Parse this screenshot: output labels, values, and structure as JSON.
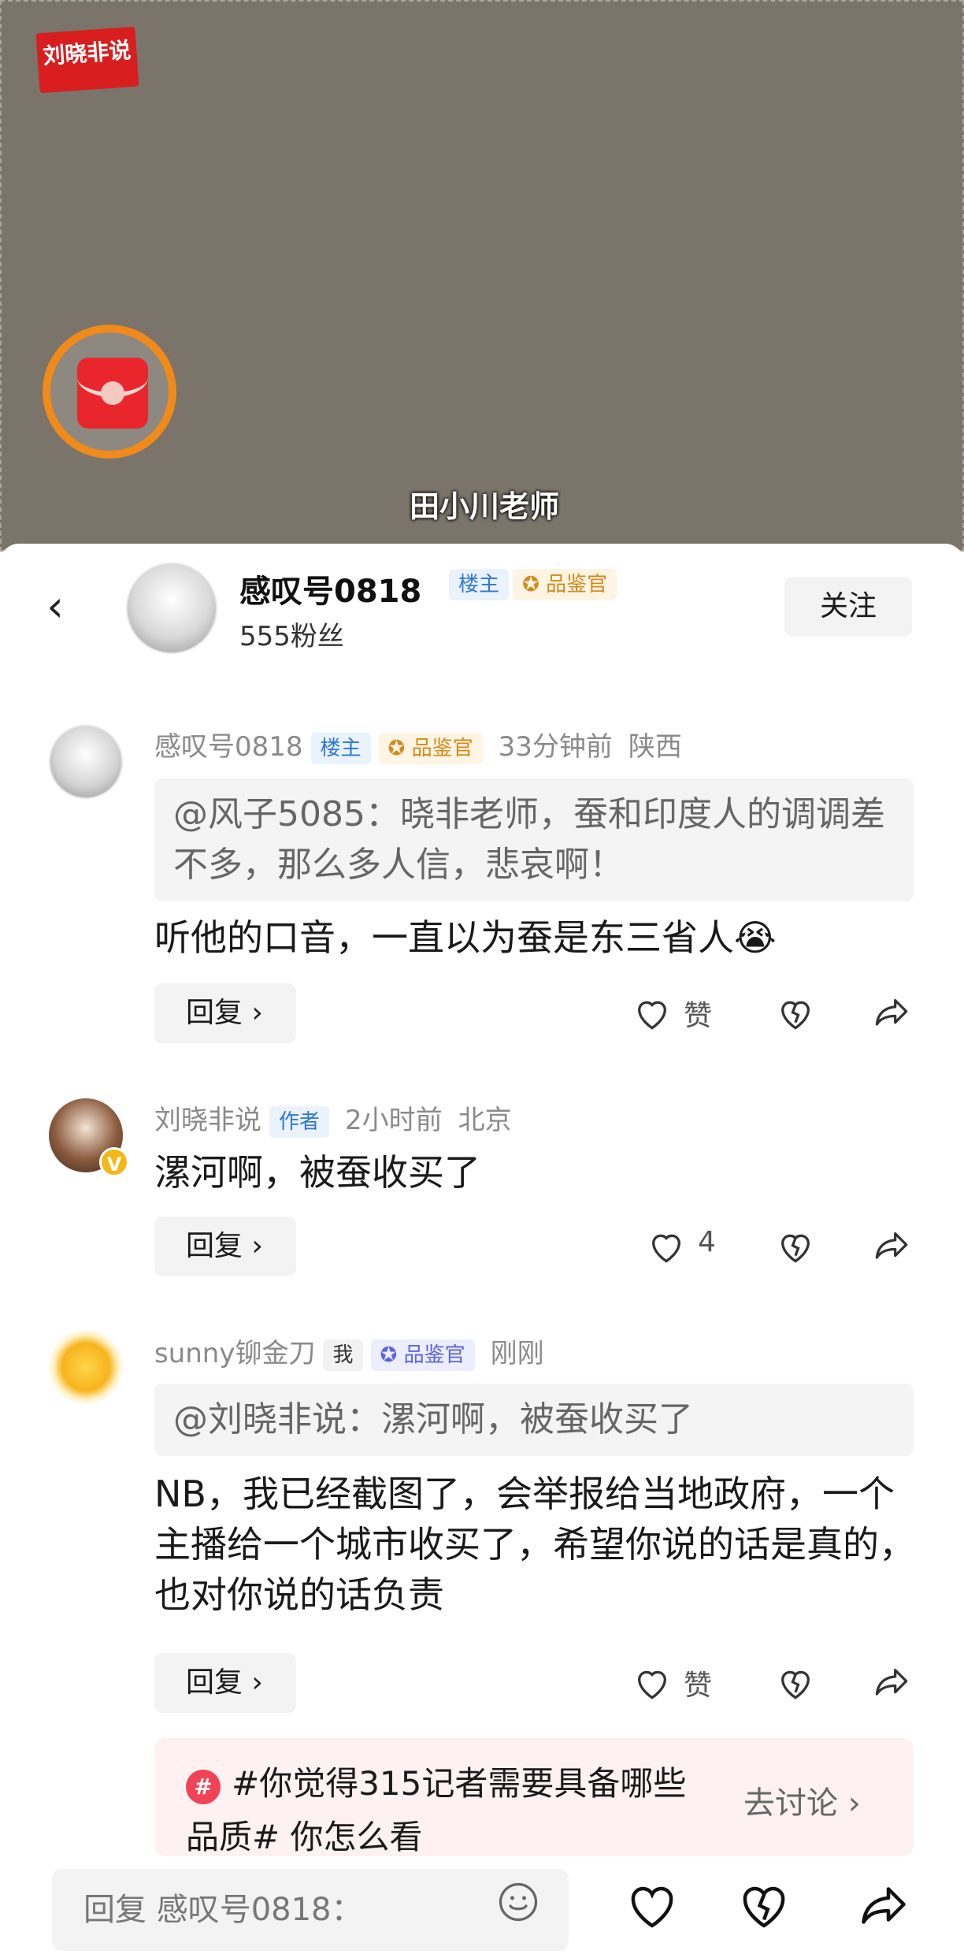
{
  "video": {
    "logo_text": "刘晓非说",
    "caption": "田小川老师"
  },
  "header": {
    "back_icon": "back-arrow-icon",
    "name": "感叹号0818",
    "badge_owner": "楼主",
    "badge_critic": "品鉴官",
    "fans": "555粉丝",
    "follow_label": "关注"
  },
  "comments": [
    {
      "user": "感叹号0818",
      "badge_owner": "楼主",
      "badge_critic": "品鉴官",
      "time": "33分钟前",
      "location": "陕西",
      "quote": "@风子5085：晓非老师，蚕和印度人的调调差不多，那么多人信，悲哀啊！",
      "text": "听他的口音，一直以为蚕是东三省人😭",
      "reply_label": "回复 ›",
      "like_label": "赞"
    },
    {
      "user": "刘晓非说",
      "badge_author": "作者",
      "time": "2小时前",
      "location": "北京",
      "text": "漯河啊，被蚕收买了",
      "reply_label": "回复 ›",
      "like_count": "4"
    },
    {
      "user": "sunny铆金刀",
      "badge_me": "我",
      "badge_critic": "品鉴官",
      "time": "刚刚",
      "quote": "@刘晓非说：漯河啊，被蚕收买了",
      "text": "NB，我已经截图了，会举报给当地政府，一个主播给一个城市收买了，希望你说的话是真的，也对你说的话负责",
      "reply_label": "回复 ›",
      "like_label": "赞"
    }
  ],
  "topic": {
    "icon": "#",
    "text": "#你觉得315记者需要具备哪些品质# 你怎么看",
    "go_label": "去讨论 ›"
  },
  "bottom_bar": {
    "reply_placeholder": "回复 感叹号0818：",
    "icons": [
      "emoji-icon",
      "like-icon",
      "dislike-icon",
      "share-icon"
    ]
  },
  "colors": {
    "owner_badge": "#2f77d9",
    "critic_badge": "#d48a1a",
    "topic_accent": "#ef4456",
    "redpacket_ring": "#f08a1a"
  }
}
